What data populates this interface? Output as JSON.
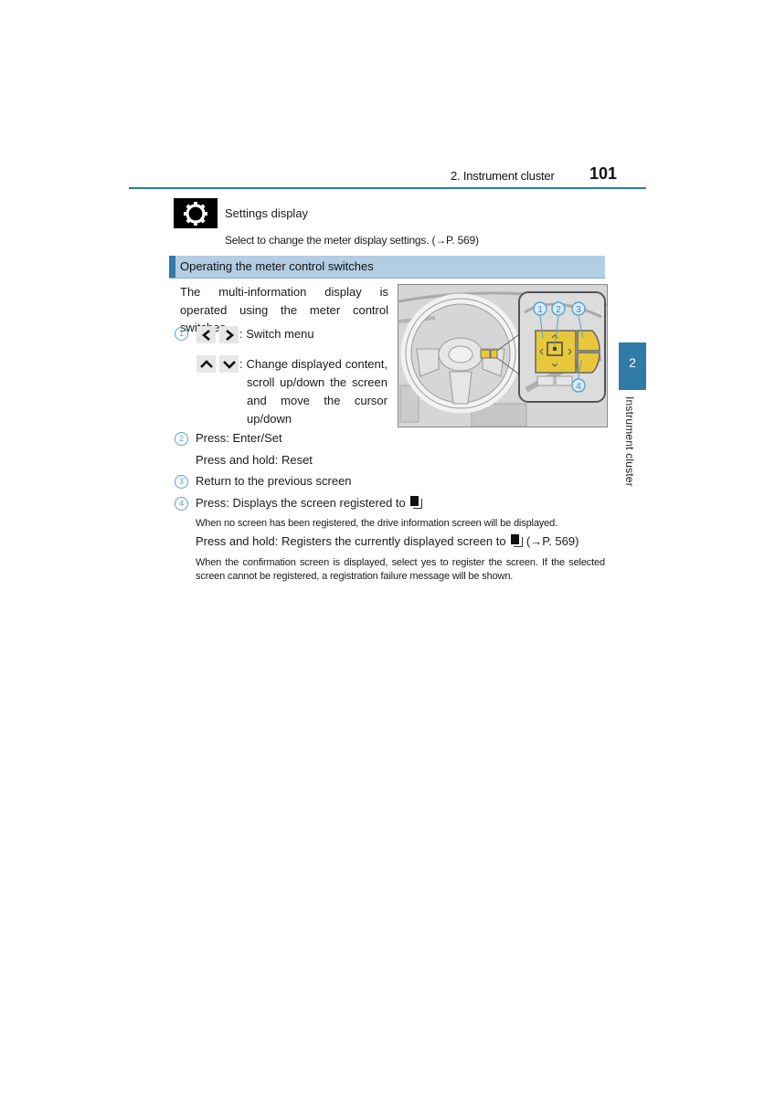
{
  "header": {
    "section": "2. Instrument cluster",
    "page_number": "101"
  },
  "settings_entry": {
    "icon": "gear-icon",
    "title": "Settings display",
    "description": "Select to change the meter display settings. (→P. 569)"
  },
  "section": {
    "heading": "Operating the meter control switches",
    "intro": "The multi-information display is operated using the meter control switches."
  },
  "items": [
    {
      "number": "1",
      "rows": [
        {
          "keys": [
            "left-arrow-icon",
            "right-arrow-icon"
          ],
          "description": ": Switch menu"
        },
        {
          "keys": [
            "up-arrow-icon",
            "down-arrow-icon"
          ],
          "description": ": Change displayed content, scroll up/down the screen and move the cursor up/down"
        }
      ]
    },
    {
      "number": "2",
      "lines": [
        "Press: Enter/Set",
        "Press and hold: Reset"
      ]
    },
    {
      "number": "3",
      "lines": [
        "Return to the previous screen"
      ]
    },
    {
      "number": "4",
      "press": "Press: Displays the screen registered to",
      "press_note": "When no screen has been registered, the drive information screen will be displayed.",
      "hold": "Press and hold: Registers the currently displayed screen to",
      "hold_ref": "(→P. 569)",
      "hold_note": "When the confirmation screen is displayed, select yes to register the screen. If the selected screen cannot be registered, a registration failure message will be shown."
    }
  ],
  "figure": {
    "callouts": [
      "1",
      "2",
      "3",
      "4"
    ],
    "highlight_color": "#e8c83a"
  },
  "side_tab": {
    "number": "2",
    "label": "Instrument cluster"
  },
  "colors": {
    "accent": "#2f7aa7",
    "heading_bg": "#b3cde3",
    "callout": "#5aa0cc"
  }
}
